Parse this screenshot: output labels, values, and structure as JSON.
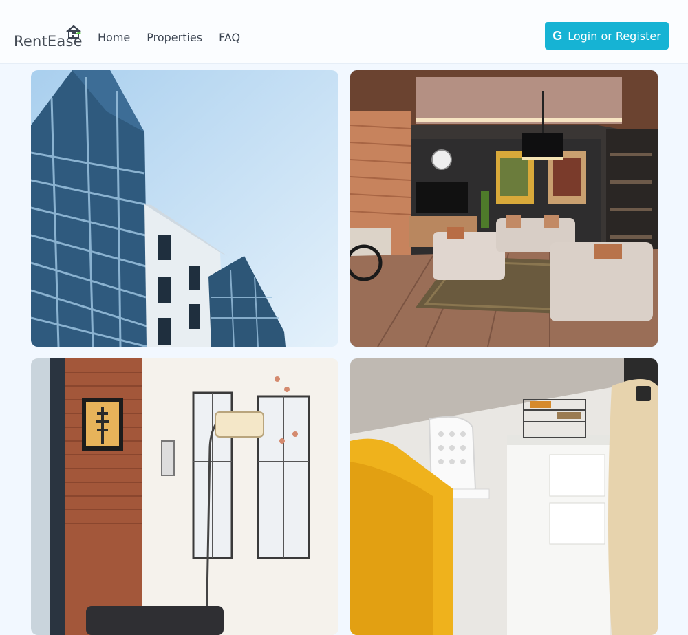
{
  "brand": {
    "name": "RentEase",
    "logo_icon": "house-icon"
  },
  "nav": {
    "home": "Home",
    "properties": "Properties",
    "faq": "FAQ"
  },
  "auth": {
    "login_label": "Login or Register",
    "icon": "google-icon"
  },
  "colors": {
    "accent": "#16b3d4",
    "page_bg": "#f2f8ff",
    "header_bg": "#fbfdff",
    "text": "#3c4552"
  },
  "gallery": {
    "images": [
      {
        "icon": "building-exterior-photo"
      },
      {
        "icon": "living-room-photo"
      },
      {
        "icon": "apartment-interior-photo"
      },
      {
        "icon": "home-office-photo"
      }
    ]
  }
}
